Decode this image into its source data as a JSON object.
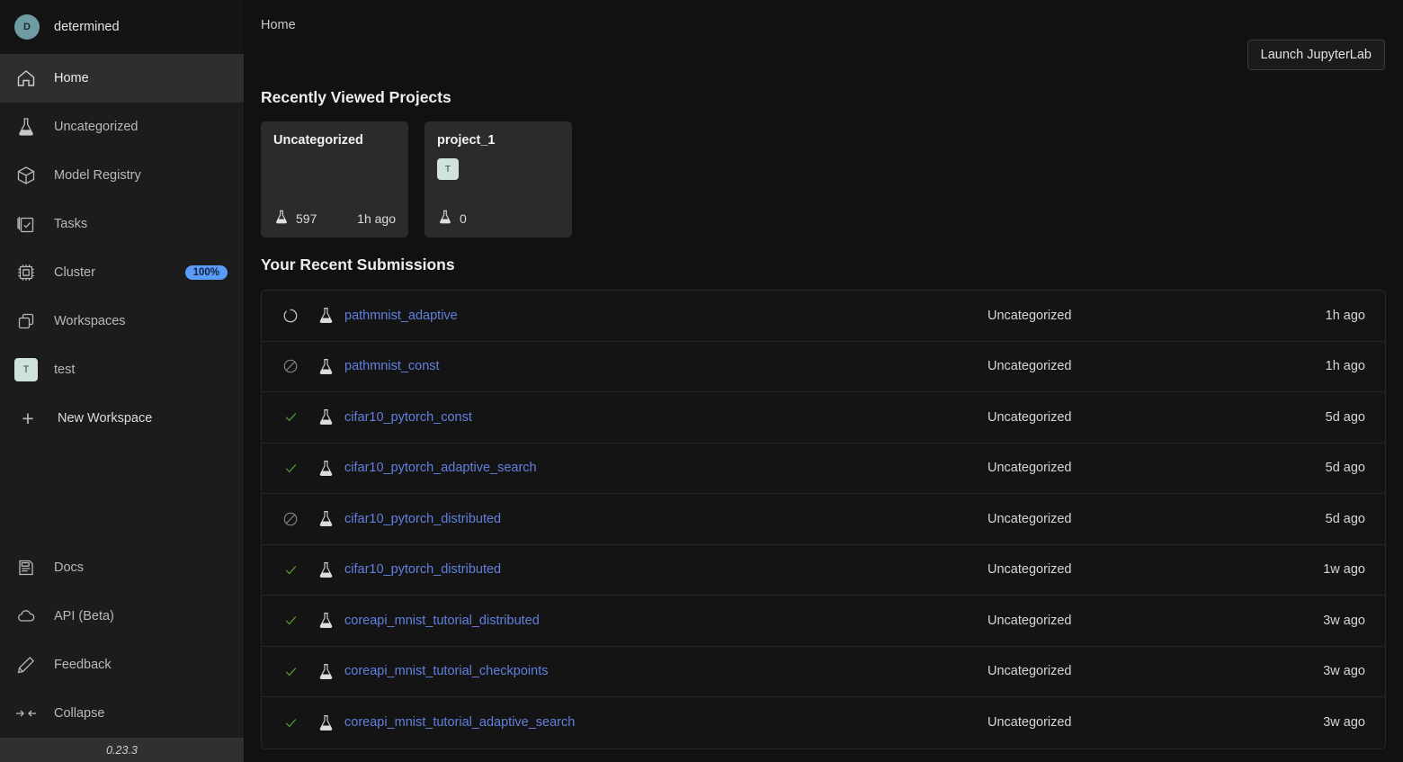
{
  "sidebar": {
    "user": {
      "initial": "D",
      "name": "determined"
    },
    "items": [
      {
        "label": "Home",
        "icon": "home-icon",
        "active": true
      },
      {
        "label": "Uncategorized",
        "icon": "flask-icon",
        "active": false
      },
      {
        "label": "Model Registry",
        "icon": "cube-icon",
        "active": false
      },
      {
        "label": "Tasks",
        "icon": "tasks-icon",
        "active": false
      },
      {
        "label": "Cluster",
        "icon": "chip-icon",
        "active": false,
        "badge": "100%"
      },
      {
        "label": "Workspaces",
        "icon": "workspaces-icon",
        "active": false
      },
      {
        "label": "test",
        "icon": "workspace-square",
        "square": "T",
        "active": false
      },
      {
        "label": "New Workspace",
        "icon": "plus-icon",
        "active": false
      }
    ],
    "footer_items": [
      {
        "label": "Docs",
        "icon": "docs-icon"
      },
      {
        "label": "API (Beta)",
        "icon": "cloud-icon"
      },
      {
        "label": "Feedback",
        "icon": "pencil-icon"
      },
      {
        "label": "Collapse",
        "icon": "collapse-icon"
      }
    ],
    "version": "0.23.3"
  },
  "header": {
    "breadcrumb": "Home",
    "launch_button": "Launch JupyterLab"
  },
  "projects": {
    "title": "Recently Viewed Projects",
    "cards": [
      {
        "name": "Uncategorized",
        "count": "597",
        "time": "1h ago",
        "square": ""
      },
      {
        "name": "project_1",
        "count": "0",
        "time": "",
        "square": "T"
      }
    ]
  },
  "submissions": {
    "title": "Your Recent Submissions",
    "rows": [
      {
        "status": "running",
        "kind": "flask-icon",
        "name": "pathmnist_adaptive",
        "project": "Uncategorized",
        "time": "1h ago"
      },
      {
        "status": "canceled",
        "kind": "flask-icon",
        "name": "pathmnist_const",
        "project": "Uncategorized",
        "time": "1h ago"
      },
      {
        "status": "completed",
        "kind": "flask-icon",
        "name": "cifar10_pytorch_const",
        "project": "Uncategorized",
        "time": "5d ago"
      },
      {
        "status": "completed",
        "kind": "flask-icon",
        "name": "cifar10_pytorch_adaptive_search",
        "project": "Uncategorized",
        "time": "5d ago"
      },
      {
        "status": "canceled",
        "kind": "flask-icon",
        "name": "cifar10_pytorch_distributed",
        "project": "Uncategorized",
        "time": "5d ago"
      },
      {
        "status": "completed",
        "kind": "flask-icon",
        "name": "cifar10_pytorch_distributed",
        "project": "Uncategorized",
        "time": "1w ago"
      },
      {
        "status": "completed",
        "kind": "flask-icon",
        "name": "coreapi_mnist_tutorial_distributed",
        "project": "Uncategorized",
        "time": "3w ago"
      },
      {
        "status": "completed",
        "kind": "flask-icon",
        "name": "coreapi_mnist_tutorial_checkpoints",
        "project": "Uncategorized",
        "time": "3w ago"
      },
      {
        "status": "completed",
        "kind": "flask-icon",
        "name": "coreapi_mnist_tutorial_adaptive_search",
        "project": "Uncategorized",
        "time": "3w ago"
      }
    ]
  },
  "colors": {
    "accent_blue": "#5b9bf8",
    "link_blue": "#6180de",
    "success_green": "#4f9a35",
    "avatar_teal": "#6f9ba3",
    "workspace_mint": "#cfe3da",
    "sidebar_bg": "#1c1c1c",
    "main_bg": "#111111"
  }
}
